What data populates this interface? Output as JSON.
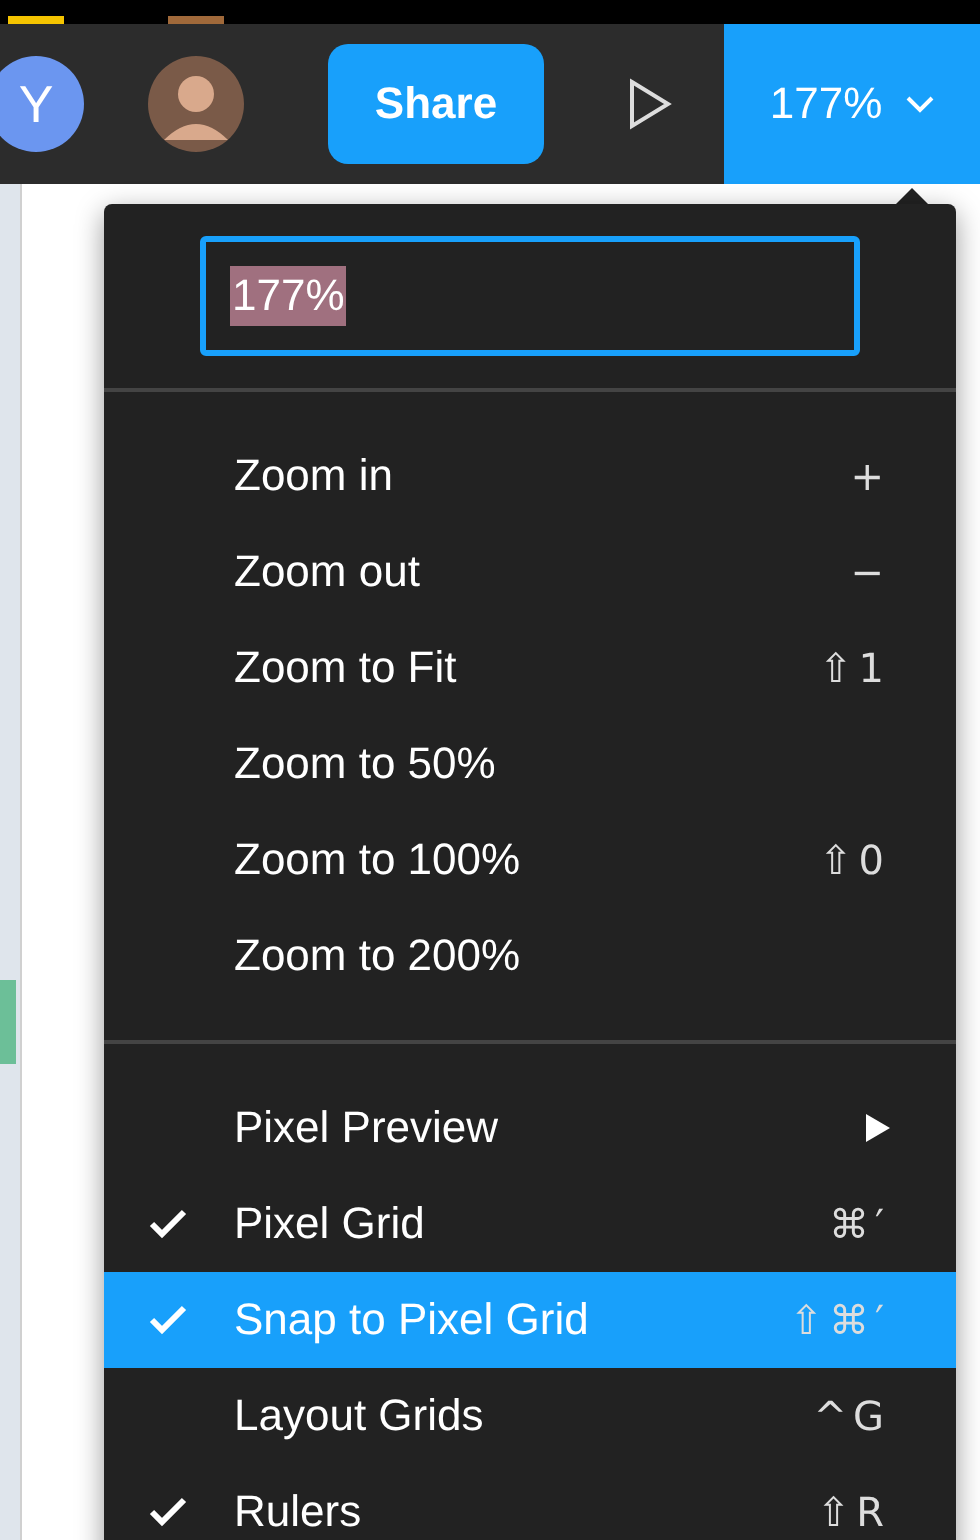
{
  "presence_bars": [
    {
      "color": "#f5c400"
    },
    {
      "color": "#a0693a"
    }
  ],
  "toolbar": {
    "avatar_initial": "Y",
    "share_button": "Share",
    "zoom_button": "177%"
  },
  "zoom_menu": {
    "field": {
      "value": "177%",
      "text_selected": true
    },
    "groups": [
      [
        {
          "kind": "item",
          "label": "Zoom in",
          "shortcut": "+",
          "checked": false,
          "selected": false
        },
        {
          "kind": "item",
          "label": "Zoom out",
          "shortcut": "−",
          "checked": false,
          "selected": false
        },
        {
          "kind": "item",
          "label": "Zoom to Fit",
          "shortcut": "⇧1",
          "checked": false,
          "selected": false
        },
        {
          "kind": "item",
          "label": "Zoom to 50%",
          "checked": false,
          "selected": false
        },
        {
          "kind": "item",
          "label": "Zoom to 100%",
          "shortcut": "⇧0",
          "checked": false,
          "selected": false
        },
        {
          "kind": "item",
          "label": "Zoom to 200%",
          "checked": false,
          "selected": false
        }
      ],
      [
        {
          "kind": "submenu",
          "label": "Pixel Preview",
          "checked": false,
          "selected": false
        },
        {
          "kind": "item",
          "label": "Pixel Grid",
          "shortcut": "⌘′",
          "checked": true,
          "selected": false
        },
        {
          "kind": "item",
          "label": "Snap to Pixel Grid",
          "shortcut": "⇧⌘′",
          "checked": true,
          "selected": true
        },
        {
          "kind": "item",
          "label": "Layout Grids",
          "shortcut": "^G",
          "checked": false,
          "selected": false
        },
        {
          "kind": "item",
          "label": "Rulers",
          "shortcut": "⇧R",
          "checked": true,
          "selected": false
        }
      ]
    ]
  }
}
